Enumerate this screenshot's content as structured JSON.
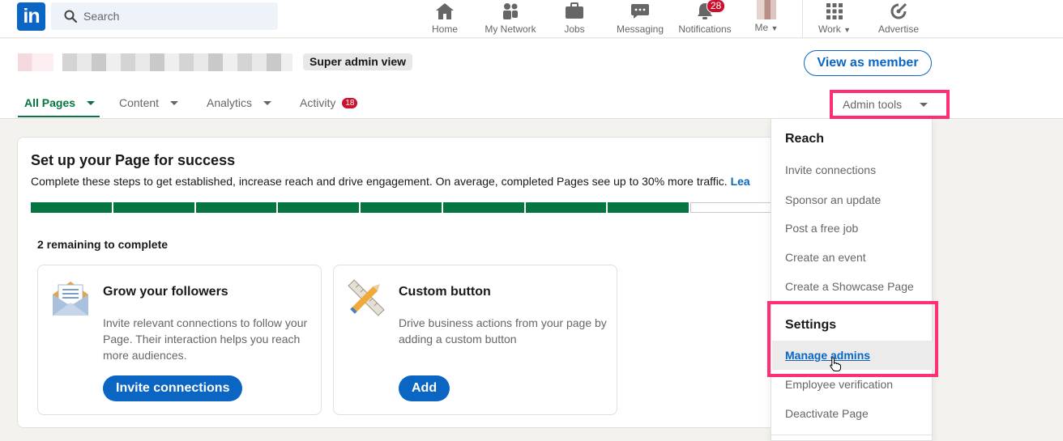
{
  "topnav": {
    "logo_text": "in",
    "search_placeholder": "Search",
    "items": [
      {
        "label": "Home",
        "icon": "home-icon"
      },
      {
        "label": "My Network",
        "icon": "people-icon"
      },
      {
        "label": "Jobs",
        "icon": "briefcase-icon"
      },
      {
        "label": "Messaging",
        "icon": "chat-icon"
      },
      {
        "label": "Notifications",
        "icon": "bell-icon",
        "badge": "28"
      },
      {
        "label": "Me",
        "icon": "avatar"
      },
      {
        "label": "Work",
        "icon": "grid-icon"
      },
      {
        "label": "Advertise",
        "icon": "compass-icon"
      }
    ]
  },
  "page_header": {
    "badge": "Super admin view",
    "view_as_member": "View as member",
    "tabs": [
      {
        "label": "All Pages"
      },
      {
        "label": "Content"
      },
      {
        "label": "Analytics"
      },
      {
        "label": "Activity",
        "count": "18"
      }
    ],
    "admin_tools": "Admin tools"
  },
  "card": {
    "title": "Set up your Page for success",
    "subtitle": "Complete these steps to get established, increase reach and drive engagement. On average, completed Pages see up to 30% more traffic.",
    "learn_more": "Lea",
    "progress": {
      "completed": 8,
      "total": 9
    },
    "remaining": "2 remaining to complete",
    "tasks": [
      {
        "title": "Grow your followers",
        "description": "Invite relevant connections to follow your Page. Their interaction helps you reach more audiences.",
        "button": "Invite connections",
        "icon": "envelope-icon"
      },
      {
        "title": "Custom button",
        "description": "Drive business actions from your page by adding a custom button",
        "button": "Add",
        "icon": "ruler-pencil-icon"
      }
    ]
  },
  "dropdown": {
    "reach_heading": "Reach",
    "reach_items": [
      "Invite connections",
      "Sponsor an update",
      "Post a free job",
      "Create an event",
      "Create a Showcase Page"
    ],
    "settings_heading": "Settings",
    "settings_items": [
      "Manage admins",
      "Employee verification",
      "Deactivate Page"
    ]
  },
  "colors": {
    "brand": "#0a66c2",
    "active_green": "#057642",
    "highlight": "#ff2f73",
    "badge_red": "#cb112d"
  }
}
